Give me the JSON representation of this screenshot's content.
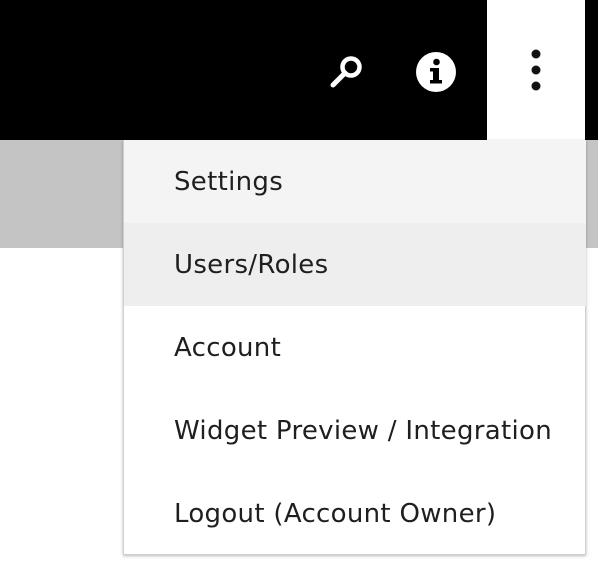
{
  "header": {
    "icons": [
      "search-icon",
      "info-icon",
      "more-vertical-icon"
    ],
    "background_color": "#000000",
    "icon_color": "#ffffff"
  },
  "menu": {
    "items": [
      {
        "label": "Settings"
      },
      {
        "label": "Users/Roles"
      },
      {
        "label": "Account"
      },
      {
        "label": "Widget Preview / Integration"
      },
      {
        "label": "Logout (Account Owner)"
      }
    ]
  }
}
